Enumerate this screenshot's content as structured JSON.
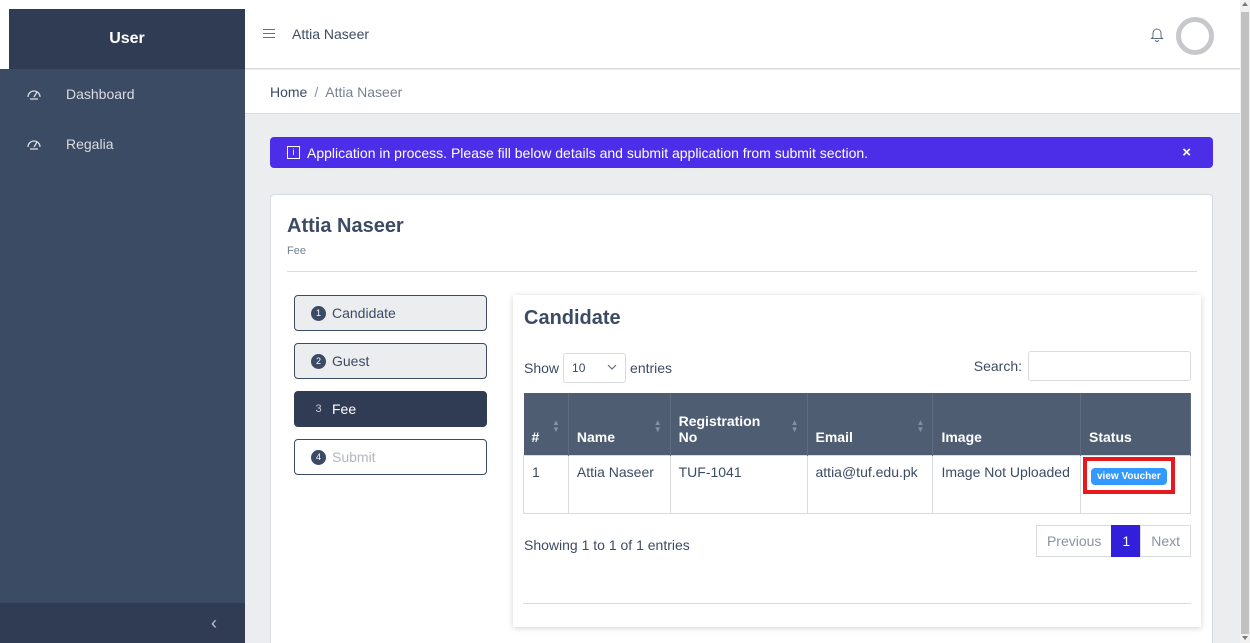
{
  "sidebar": {
    "brand": "User",
    "items": [
      {
        "label": "Dashboard",
        "icon": "speedometer-icon"
      },
      {
        "label": "Regalia",
        "icon": "speedometer-icon"
      }
    ],
    "toggler": "‹"
  },
  "header": {
    "title": "Attia Naseer"
  },
  "breadcrumb": {
    "home": "Home",
    "separator": "/",
    "current": "Attia Naseer"
  },
  "alert": {
    "icon_glyph": "i",
    "message": "Application in process. Please fill below details and submit application from submit section.",
    "close": "×"
  },
  "card": {
    "title": "Attia Naseer",
    "subtitle": "Fee"
  },
  "steps": [
    {
      "num": "1",
      "label": "Candidate",
      "state": "default"
    },
    {
      "num": "2",
      "label": "Guest",
      "state": "default"
    },
    {
      "num": "3",
      "label": "Fee",
      "state": "active"
    },
    {
      "num": "4",
      "label": "Submit",
      "state": "disabled"
    }
  ],
  "panel": {
    "title": "Candidate",
    "show_label": "Show",
    "entries_value": "10",
    "entries_label": "entries",
    "search_label": "Search:",
    "search_value": "",
    "columns": [
      "#",
      "Name",
      "Registration No",
      "Email",
      "Image",
      "Status"
    ],
    "rows": [
      {
        "index": "1",
        "name": "Attia Naseer",
        "registration_no": "TUF-1041",
        "email": "attia@tuf.edu.pk",
        "image": "Image Not Uploaded",
        "status_button": "view Voucher"
      }
    ],
    "showing": "Showing 1 to 1 of 1 entries",
    "pagination": {
      "previous": "Previous",
      "current": "1",
      "next": "Next"
    }
  },
  "colors": {
    "sidebar": "#3c4b64",
    "alert": "#4d2ee8",
    "primary": "#321fdb",
    "info_button": "#3399ff",
    "highlight": "#e6191e"
  }
}
